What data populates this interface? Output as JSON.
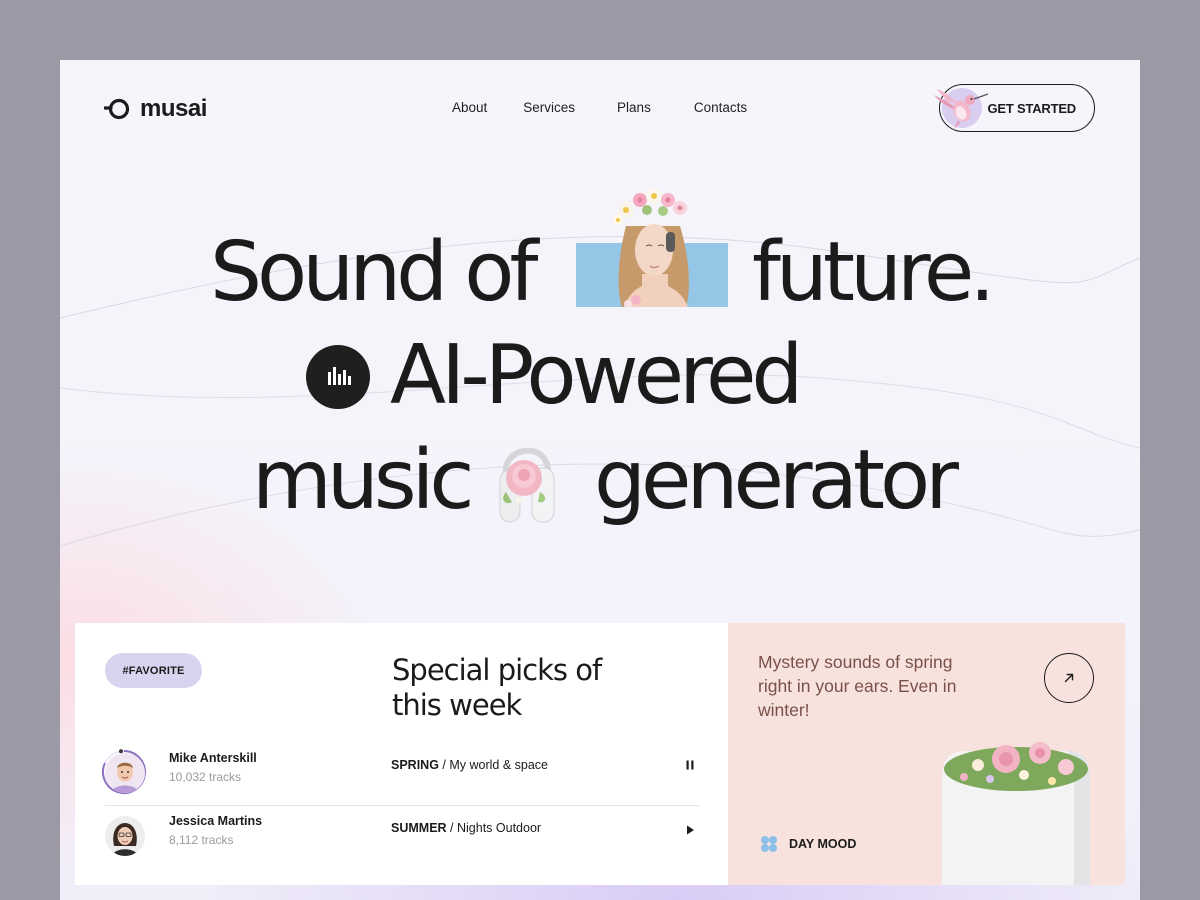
{
  "brand": {
    "name": "musai"
  },
  "nav": {
    "items": [
      "About",
      "Services",
      "Plans",
      "Contacts"
    ]
  },
  "cta": {
    "label": "GET STARTED"
  },
  "hero": {
    "line1_a": "Sound of",
    "line1_b": "future.",
    "line2": "AI-Powered",
    "line3_a": "music",
    "line3_b": "generator"
  },
  "picks": {
    "tag": "#FAVORITE",
    "title": "Special picks of this week",
    "rows": [
      {
        "name": "Mike Anterskill",
        "tracks": "10,032 tracks",
        "season": "SPRING",
        "sep": " / ",
        "title": "My world & space",
        "control": "pause-icon"
      },
      {
        "name": "Jessica Martins",
        "tracks": "8,112 tracks",
        "season": "SUMMER",
        "sep": " / ",
        "title": "Nights Outdoor",
        "control": "play-icon"
      }
    ]
  },
  "mood": {
    "text": "Mystery sounds of spring right in your ears. Even in winter!",
    "label": "DAY MOOD",
    "icon": "clover-icon"
  },
  "colors": {
    "background": "#9b99a5",
    "page": "#f5f4fb",
    "tag": "#d9d3ef",
    "mood_card": "#f7e2dd",
    "mood_text": "#7a5148",
    "mood_icon": "#8cc0e8",
    "image_bg": "#95c6e6"
  }
}
